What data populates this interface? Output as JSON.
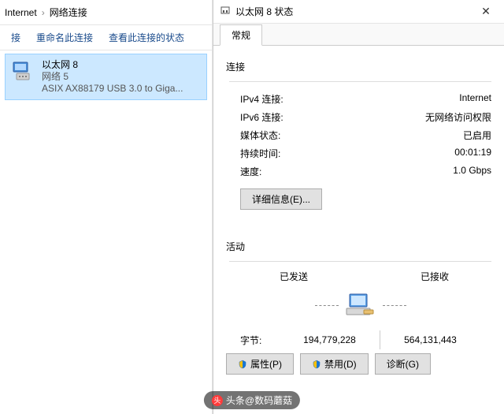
{
  "breadcrumb": {
    "item1": "Internet",
    "item2": "网络连接"
  },
  "toolbar": {
    "connect": "接",
    "rename": "重命名此连接",
    "status": "查看此连接的状态"
  },
  "connection": {
    "name": "以太网 8",
    "network": "网络 5",
    "adapter": "ASIX AX88179 USB 3.0 to Giga..."
  },
  "dialog": {
    "title": "以太网 8 状态",
    "tab": "常规",
    "section_connection": "连接",
    "rows": {
      "ipv4_label": "IPv4 连接:",
      "ipv4_value": "Internet",
      "ipv6_label": "IPv6 连接:",
      "ipv6_value": "无网络访问权限",
      "media_label": "媒体状态:",
      "media_value": "已启用",
      "duration_label": "持续时间:",
      "duration_value": "00:01:19",
      "speed_label": "速度:",
      "speed_value": "1.0 Gbps"
    },
    "details_btn": "详细信息(E)...",
    "section_activity": "活动",
    "sent_label": "已发送",
    "recv_label": "已接收",
    "bytes_label": "字节:",
    "sent_bytes": "194,779,228",
    "recv_bytes": "564,131,443",
    "props_btn": "属性(P)",
    "disable_btn": "禁用(D)",
    "diag_btn": "诊断(G)"
  },
  "watermark": "头条@数码蘑菇"
}
